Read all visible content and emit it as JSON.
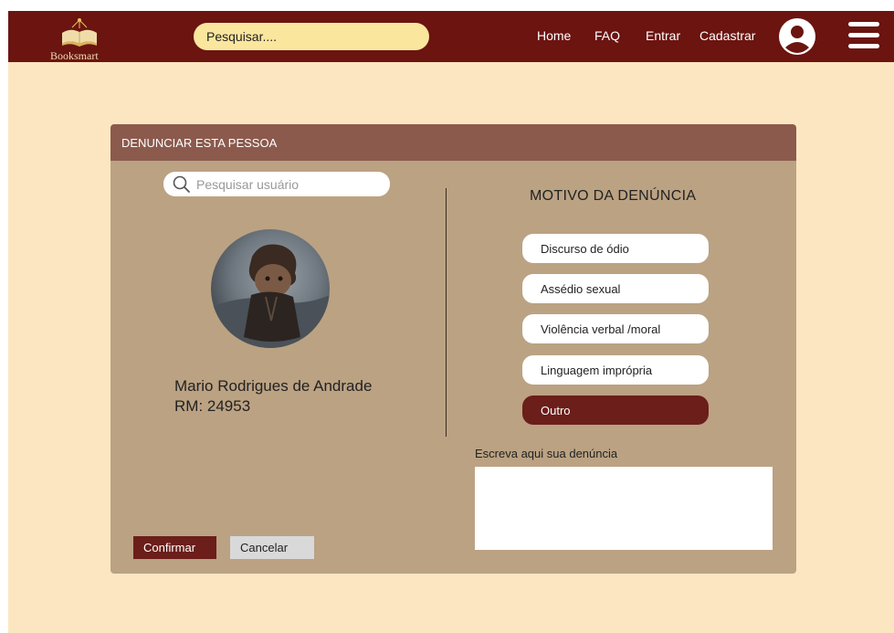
{
  "brand": {
    "name": "Booksmart",
    "logo_icon": "open-book-icon"
  },
  "header": {
    "search_placeholder": "Pesquisar....",
    "nav": [
      {
        "label": "Home"
      },
      {
        "label": "FAQ"
      },
      {
        "label": "Entrar"
      },
      {
        "label": "Cadastrar"
      }
    ],
    "profile_icon": "user-circle-icon",
    "menu_icon": "hamburger-menu-icon"
  },
  "report": {
    "title": "DENUNCIAR ESTA PESSOA",
    "user_search_placeholder": "Pesquisar usuário",
    "user": {
      "name": "Mario Rodrigues de Andrade",
      "rm": "RM: 24953"
    },
    "reasons_title": "MOTIVO DA DENÚNCIA",
    "reasons": [
      {
        "label": "Discurso de ódio",
        "selected": false
      },
      {
        "label": "Assédio sexual",
        "selected": false
      },
      {
        "label": "Violência verbal /moral",
        "selected": false
      },
      {
        "label": "Linguagem imprópria",
        "selected": false
      },
      {
        "label": "Outro",
        "selected": true
      }
    ],
    "write_label": "Escreva aqui sua denúncia",
    "complaint_text": "",
    "confirm_label": "Confirmar",
    "cancel_label": "Cancelar"
  },
  "colors": {
    "navbar": "#6b1410",
    "page_background": "#fce6c1",
    "dialog_body": "#bba283",
    "dialog_header": "#8b5a4d",
    "accent": "#6b1e1a",
    "search_field": "#fbe69e"
  }
}
